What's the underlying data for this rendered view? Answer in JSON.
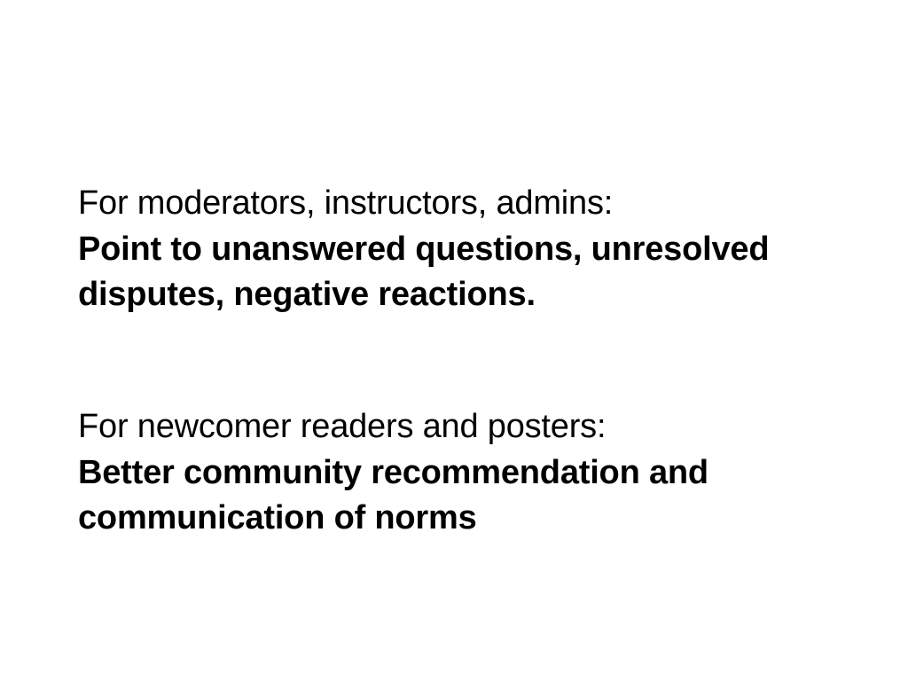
{
  "slide": {
    "section1": {
      "lead": "For moderators, instructors, admins:",
      "emphasis": "Point to unanswered questions, unresolved disputes, negative reactions."
    },
    "section2": {
      "lead": "For newcomer readers and posters:",
      "emphasis": "Better community recommendation and communication of norms"
    },
    "colors": {
      "background": "#ffffff",
      "text": "#000000"
    }
  }
}
